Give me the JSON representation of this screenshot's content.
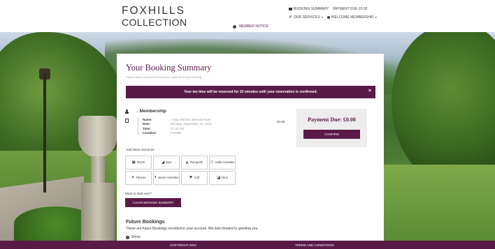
{
  "brand": {
    "line1": "FOXHILLS",
    "line2": "COLLECTION"
  },
  "topnav": {
    "booking_summary": "BOOKING SUMMARY",
    "payment_due": "PAYMENT DUE £0.00",
    "our_services": "OUR SERVICES",
    "welcome": "WELCOME MEMBERSHIP"
  },
  "member_notice": "MEMBER NOTICE",
  "summary": {
    "title": "Your Booking Summary",
    "subtitle": "Please take a moment to review the contents of your booking",
    "alert": "Your tee time will be reserved for 10 minutes until your reservation is confirmed.",
    "alert_close": "×"
  },
  "booking": {
    "heading": ". Membership",
    "labels": [
      "Name:",
      "Date:",
      "Time:",
      "Location:"
    ],
    "values": [
      "7 Day Member Bernard Hunt",
      "Monday, September 16, 2024",
      "07:45 AM",
      "Foxhills"
    ],
    "price": "£0.00"
  },
  "payment": {
    "due": "Payment Due: £0.00",
    "confirm": "CONFIRM"
  },
  "add_more": {
    "title": "Add More Services",
    "services": [
      {
        "label": "Room",
        "icon": "bed-icon",
        "glyph": "▦"
      },
      {
        "label": "Spa",
        "icon": "leaf-icon",
        "glyph": "◢"
      },
      {
        "label": "Racquets",
        "icon": "racquet-icon",
        "glyph": "◭"
      },
      {
        "label": "Adult Activities",
        "icon": "adult-activities-icon",
        "glyph": "⚇"
      },
      {
        "label": "Fitness",
        "icon": "fitness-icon",
        "glyph": "⚘"
      },
      {
        "label": "Junior Activities",
        "icon": "junior-activities-icon",
        "glyph": "☨"
      },
      {
        "label": "Golf",
        "icon": "golf-flag-icon",
        "glyph": "⚑"
      },
      {
        "label": "Dine",
        "icon": "dine-icon",
        "glyph": "◪"
      }
    ]
  },
  "start_over": {
    "prompt": "Want to start over?",
    "button": "CLEAR BOOKING SUMMARY"
  },
  "future": {
    "title": "Future Bookings",
    "text": "These are future Bookings recorded in your account. We look forward to greeting you.",
    "show": "Show"
  },
  "footer": {
    "copyright": "COPYRIGHT 2024",
    "terms": "TERMS AND CONDITIONS"
  },
  "colors": {
    "brand": "#5a1a48",
    "panel": "#ededed"
  }
}
